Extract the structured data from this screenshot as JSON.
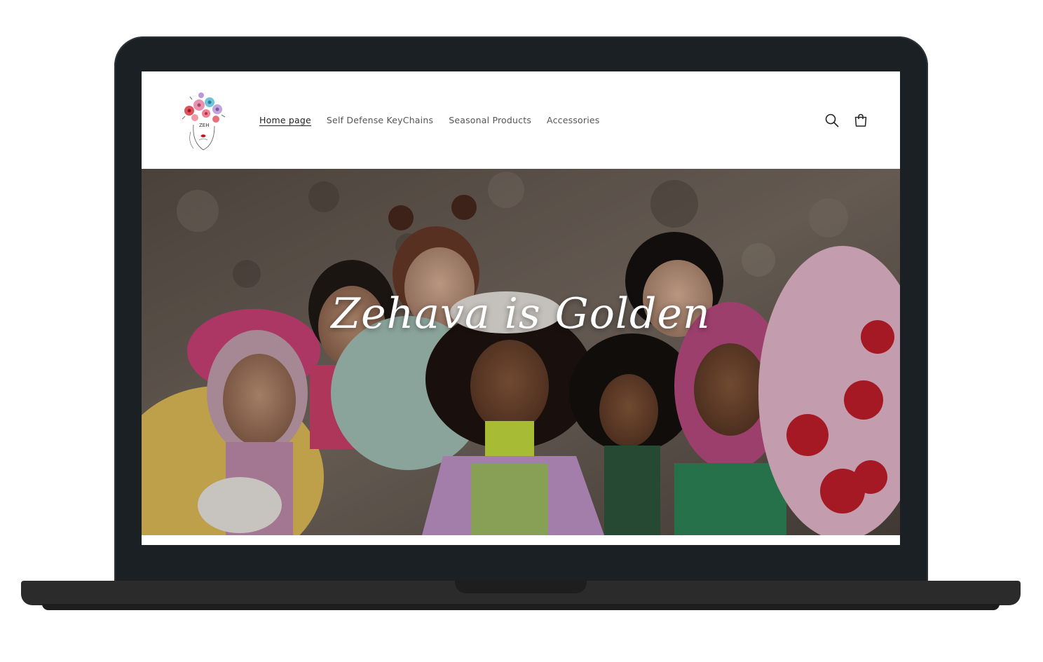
{
  "nav": {
    "items": [
      {
        "label": "Home page",
        "active": true
      },
      {
        "label": "Self Defense KeyChains",
        "active": false
      },
      {
        "label": "Seasonal Products",
        "active": false
      },
      {
        "label": "Accessories",
        "active": false
      }
    ]
  },
  "header": {
    "icons": [
      "search-icon",
      "cart-icon"
    ]
  },
  "hero": {
    "title": "Zehava is Golden"
  },
  "colors": {
    "lid": "#1b2025",
    "base": "#2b2b2b",
    "screen_bg": "#ffffff",
    "nav_text": "#555555"
  }
}
